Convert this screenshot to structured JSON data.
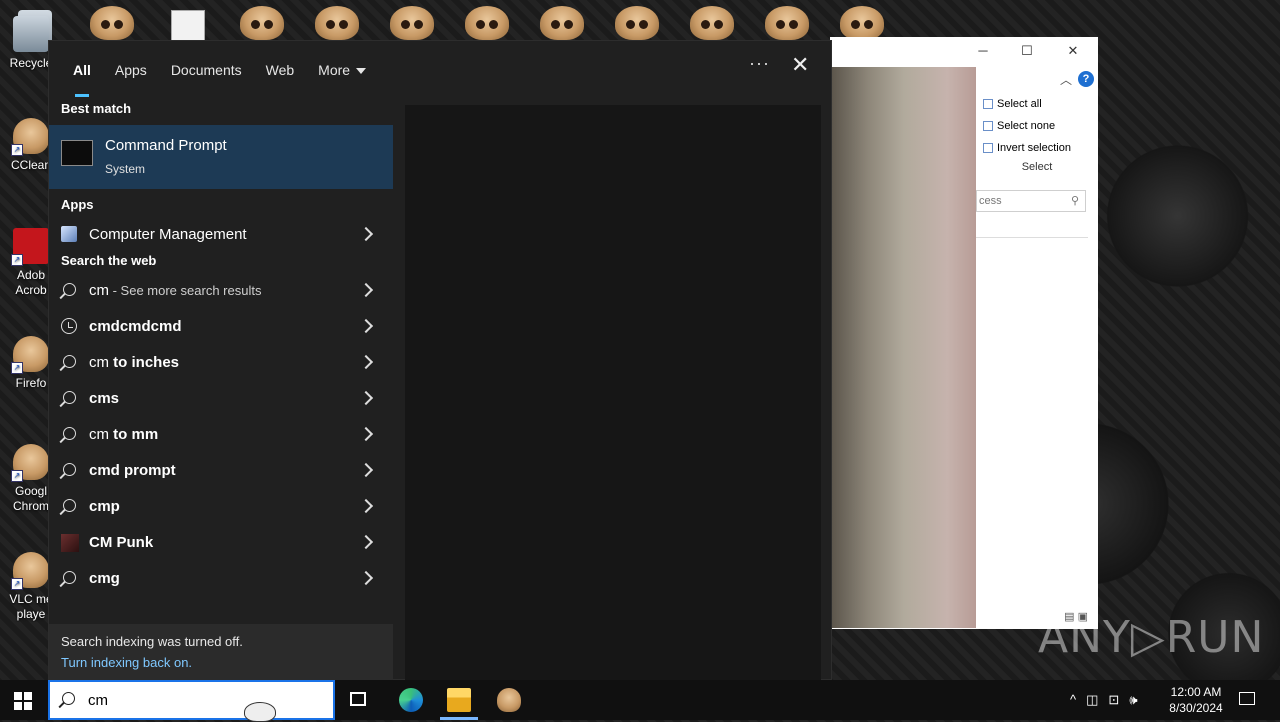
{
  "desktop": {
    "icons": [
      {
        "label": "Recycle",
        "name": "recycle-bin-icon"
      },
      {
        "label": "CClean",
        "name": "ccleaner-icon"
      },
      {
        "label": "Adob\nAcrob",
        "name": "acrobat-icon"
      },
      {
        "label": "Firefo",
        "name": "firefox-icon"
      },
      {
        "label": "Googl\nChrom",
        "name": "chrome-icon"
      },
      {
        "label": "VLC me\nplaye",
        "name": "vlc-icon"
      }
    ]
  },
  "explorer": {
    "ribbon": {
      "select_all": "Select all",
      "select_none": "Select none",
      "invert_selection": "Invert selection",
      "group_label": "Select"
    },
    "search_placeholder": "cess",
    "help_label": "?"
  },
  "search_panel": {
    "tabs": [
      {
        "label": "All",
        "active": true
      },
      {
        "label": "Apps"
      },
      {
        "label": "Documents"
      },
      {
        "label": "Web"
      },
      {
        "label": "More"
      }
    ],
    "more_label": "···",
    "close_label": "✕",
    "best_match_header": "Best match",
    "best_match": {
      "title": "Command Prompt",
      "subtitle": "System"
    },
    "apps_header": "Apps",
    "apps": [
      {
        "label": "Computer Management"
      }
    ],
    "web_header": "Search the web",
    "web_results": [
      {
        "prefix": "cm",
        "suffix": " - See more search results",
        "icon": "search-icon"
      },
      {
        "prefix": "cmdcmdcmd",
        "suffix": "",
        "icon": "history-icon"
      },
      {
        "prefix": "cm",
        "suffix": " to inches",
        "icon": "search-icon"
      },
      {
        "prefix": "cms",
        "suffix": "",
        "icon": "search-icon"
      },
      {
        "prefix": "cm",
        "suffix": " to mm",
        "icon": "search-icon"
      },
      {
        "prefix": "cmd prompt",
        "suffix": "",
        "icon": "search-icon"
      },
      {
        "prefix": "cmp",
        "suffix": "",
        "icon": "search-icon"
      },
      {
        "prefix": "CM Punk",
        "suffix": "",
        "icon": "cm-punk-icon"
      },
      {
        "prefix": "cmg",
        "suffix": "",
        "icon": "search-icon"
      }
    ],
    "indexing": {
      "message": "Search indexing was turned off.",
      "link": "Turn indexing back on."
    }
  },
  "taskbar": {
    "search_value": "cm",
    "time": "12:00 AM",
    "date": "8/30/2024"
  },
  "watermark": "ANY▷RUN"
}
